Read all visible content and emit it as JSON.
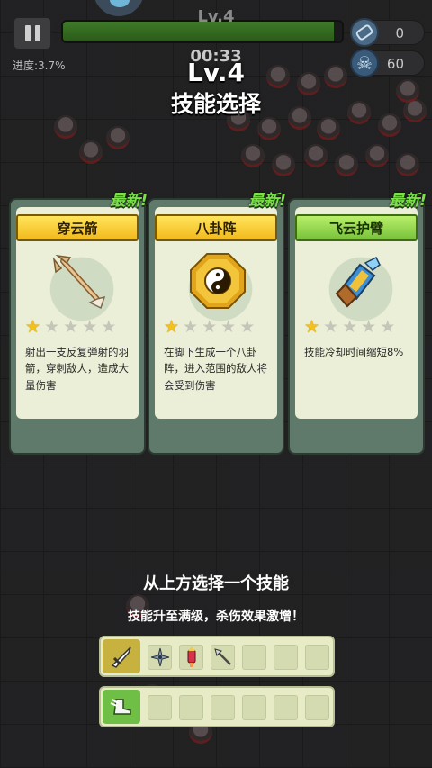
{
  "hud": {
    "level_label": "Lv.4",
    "timer": "00:33",
    "progress": "进度:3.7%",
    "xp_fraction": 0.97,
    "coins": "0",
    "kills": "60"
  },
  "header": {
    "level": "Lv.4",
    "title": "技能选择"
  },
  "cards": [
    {
      "new_tag": "最新!",
      "name": "穿云箭",
      "banner_color": "yellow",
      "icon": "arrow-icon",
      "stars_filled": 1,
      "stars_total": 5,
      "description": "射出一支反复弹射的羽箭，穿刺敌人，造成大量伤害"
    },
    {
      "new_tag": "最新!",
      "name": "八卦阵",
      "banner_color": "yellow",
      "icon": "bagua-icon",
      "stars_filled": 1,
      "stars_total": 5,
      "description": "在脚下生成一个八卦阵，进入范围的敌人将会受到伤害"
    },
    {
      "new_tag": "最新!",
      "name": "飞云护臂",
      "banner_color": "green",
      "icon": "bracer-icon",
      "stars_filled": 1,
      "stars_total": 5,
      "description": "技能冷却时间缩短8%"
    }
  ],
  "footer": {
    "hint": "从上方选择一个技能",
    "sub_hint": "技能升至满级，杀伤效果激增！"
  },
  "slots": {
    "weapons": [
      "shuriken-icon",
      "firework-icon",
      "spear-icon",
      "",
      "",
      ""
    ],
    "passives": [
      "",
      "",
      "",
      "",
      "",
      ""
    ]
  },
  "colors": {
    "star_on": "#f4c11a",
    "new_tag": "#7be04a",
    "banner_yellow": "#f3b91b",
    "banner_green": "#78c23a"
  }
}
